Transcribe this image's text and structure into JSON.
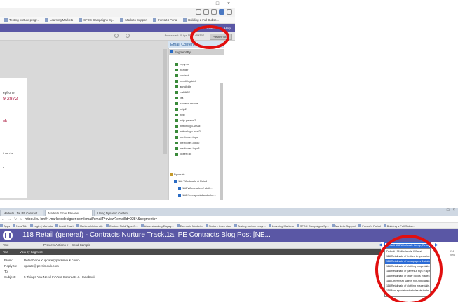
{
  "top_window": {
    "bookmarks": [
      "Testing nurture progr...",
      "Learning Markets",
      "SFDC Campaigns Sy...",
      "Marketo Support",
      "Forza24 Portal",
      "Building a Full Subsc..."
    ],
    "nav": {
      "contact_label": "Contact us",
      "help_label": "Help"
    },
    "autosave_text": "Auto-saved: 20 Apr 10:02 GMT07",
    "preview_draft_label": "Preview Draft",
    "panel_title": "Email Content",
    "segment_label": "Segment By",
    "doc_fragments": [
      "ephone",
      "9 2872",
      "ok",
      "it can be",
      "e"
    ],
    "tree_items": [
      "reply-to",
      "header",
      "contact",
      "headOrgAdd",
      "anmAddr",
      "ewBlk02",
      "cta",
      "name-surname",
      "help2",
      "help",
      "help-person2",
      "buttonlogo-small",
      "buttonlogo-next2",
      "pre-footer-logo",
      "pre-footer-logo2",
      "pre-footer-logo3",
      "footerEdit"
    ],
    "dynamic_label": "Dynamic",
    "dynamic_child": "118 Wholesale & Retail",
    "dynamic_subitems": [
      "118 Wholesale of cloth...",
      "118 Non-specialised who..."
    ]
  },
  "bottom_window": {
    "tabs": [
      "Marketo | 1a. PE Contract",
      "Marketo Email Preview",
      "Using Dynamic Content"
    ],
    "url": "https://eu-lon04.marketodesigner.com/email/emailPreview?emailId=9284&segments=",
    "bookmarks": [
      "Apps",
      "New Tab",
      "Login | Marketo",
      "Lucid Chart",
      "Marketo University",
      "Custom Field Type O...",
      "Understanding Engag...",
      "Events in Marketo",
      "Nurture track view",
      "Testing nurture progr...",
      "Learning Markets",
      "SFDC Campaigns Sy...",
      "Marketo Support",
      "Forza24 Portal",
      "Building a Full Subsc..."
    ],
    "title": "118 Retail (general) - Contracts Nurture Track.1a. PE Contracts Blog Post [NE...",
    "preview_actions_label": "Preview Actions ▾",
    "send_sample_label": "Send Sample",
    "view_by_segment_label": "View by Segment",
    "text_label": "Text",
    "email_rows": [
      {
        "label": "From:",
        "value": "Peter Done <update@persimouk.com>"
      },
      {
        "label": "Reply-to:",
        "value": "update@persimouk.com"
      },
      {
        "label": "To:",
        "value": ""
      },
      {
        "label": "Subject:",
        "value": "5 Things You Need In Your Contracts & Handbook"
      }
    ],
    "dropdown_selected": "Default 118 Wholesale &amp; Retail",
    "dropdown_options": [
      "Default 118 Wholesale & Retail",
      "118 Retail sale of textiles in specialise...",
      "118 Retail sale of newspapers & stationery",
      "118 Retail sale of clothing in specialis...",
      "118 Retail sale of games & toys in spec...",
      "118 Retail sale of other goods in spec...",
      "118 Other retail sale in non-specialise...",
      "118 Retail sale of clothing in specialis...",
      "118 Non-specialised wholesale trade"
    ],
    "zoom": "114 view"
  },
  "colors": {
    "marketo_purple": "#5a57a5",
    "highlight_red": "#e10f0f",
    "select_blue": "#2c6cd6"
  }
}
